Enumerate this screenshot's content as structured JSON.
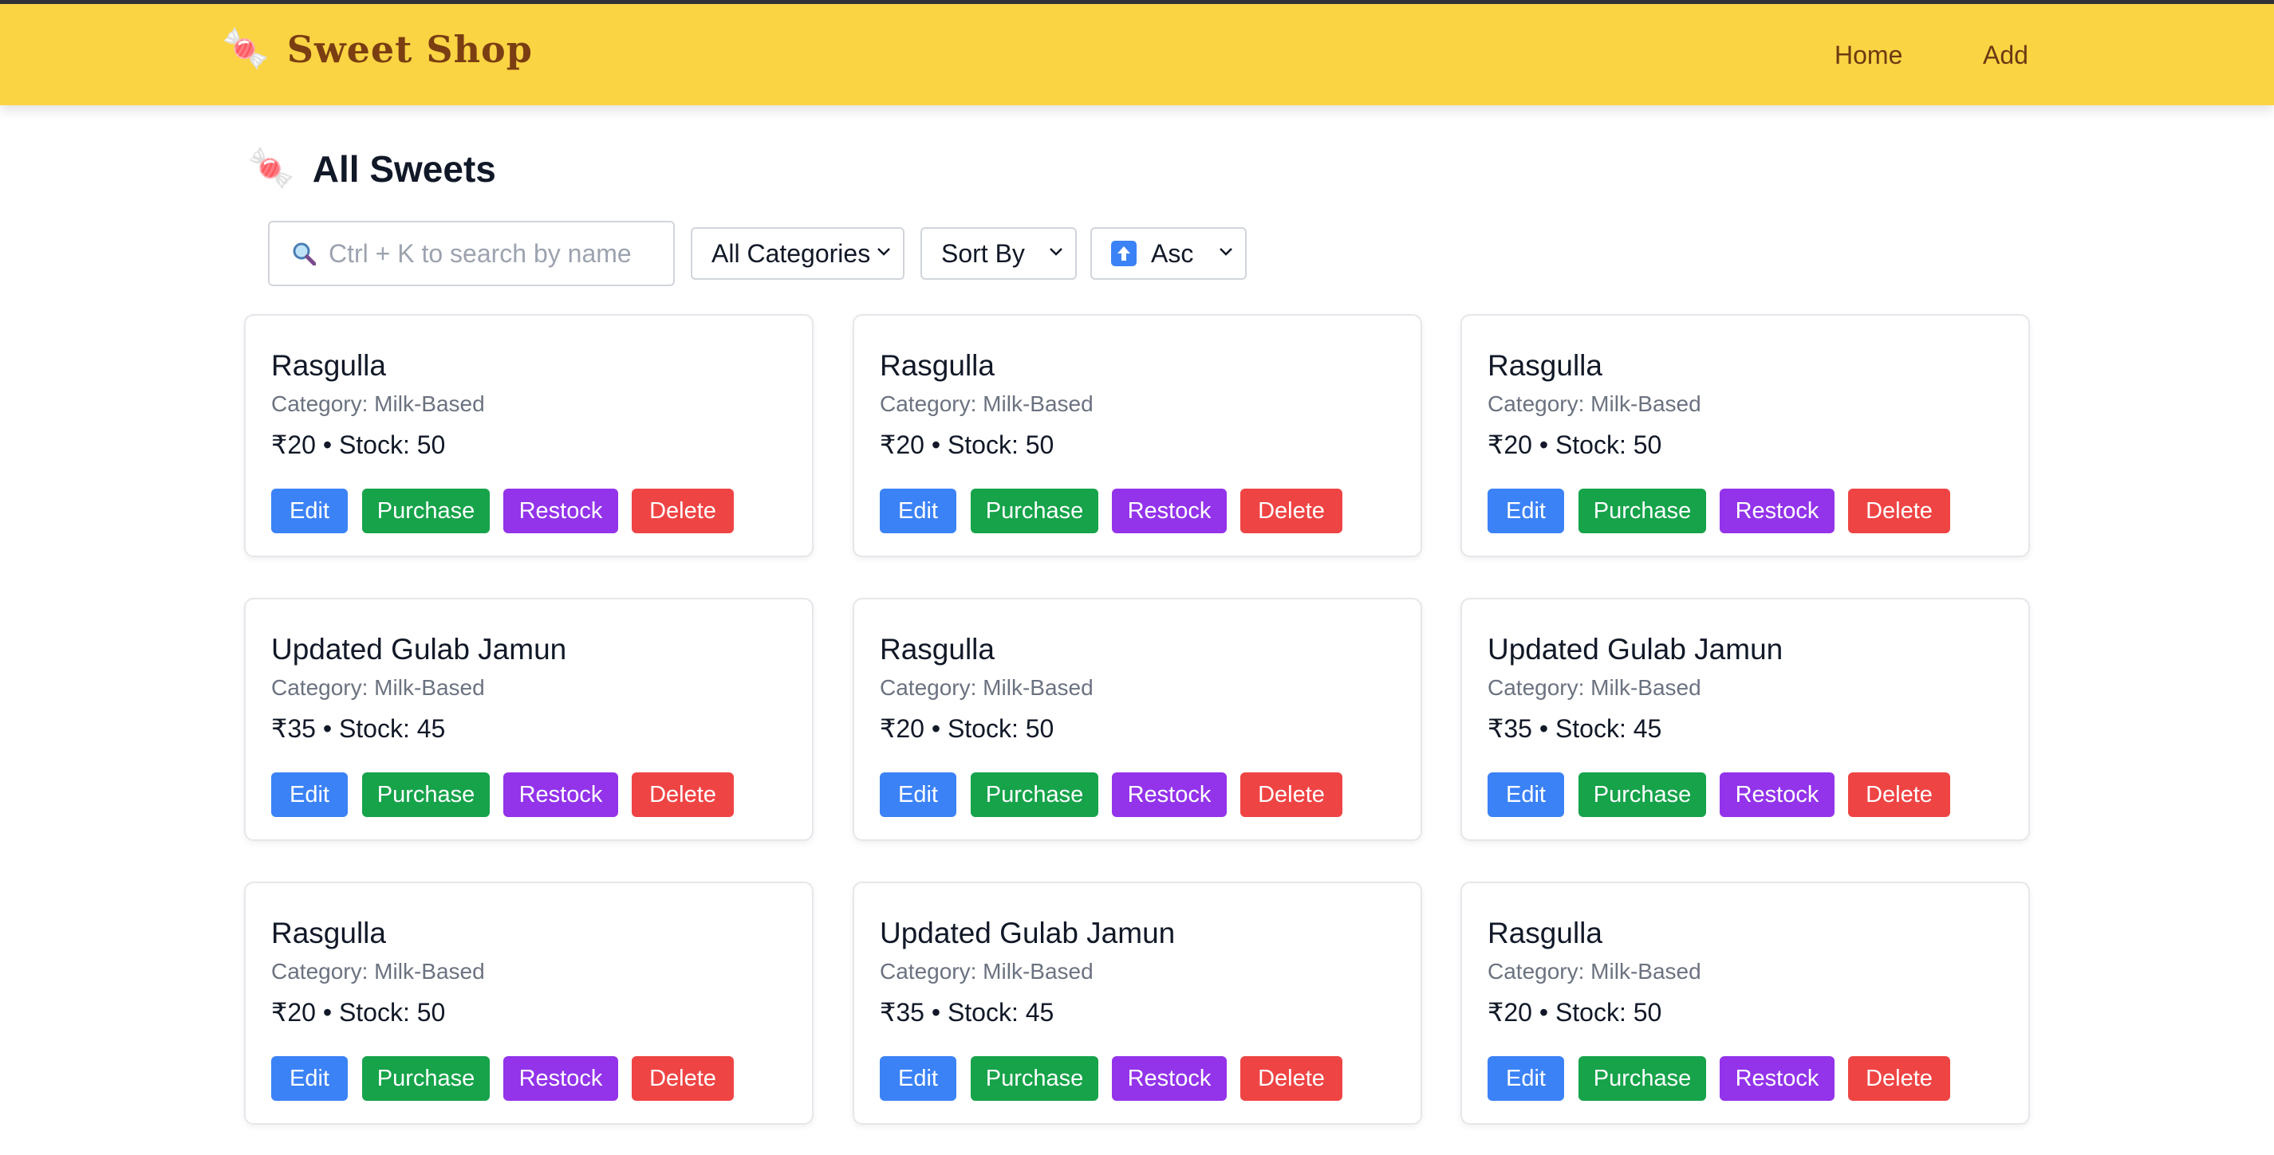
{
  "brand": {
    "icon": "candy-icon",
    "name": "Sweet Shop"
  },
  "nav": {
    "home": "Home",
    "add": "Add"
  },
  "page": {
    "icon": "candy-icon",
    "title": "All Sweets"
  },
  "controls": {
    "search_placeholder": "Ctrl + K to search by name",
    "category_select": "All Categories",
    "sort_select": "Sort By",
    "order_select": "Asc"
  },
  "buttons": {
    "edit": "Edit",
    "purchase": "Purchase",
    "restock": "Restock",
    "delete": "Delete"
  },
  "sweets": [
    {
      "name": "Rasgulla",
      "category": "Category: Milk-Based",
      "details": "₹20 • Stock: 50"
    },
    {
      "name": "Rasgulla",
      "category": "Category: Milk-Based",
      "details": "₹20 • Stock: 50"
    },
    {
      "name": "Rasgulla",
      "category": "Category: Milk-Based",
      "details": "₹20 • Stock: 50"
    },
    {
      "name": "Updated Gulab Jamun",
      "category": "Category: Milk-Based",
      "details": "₹35 • Stock: 45"
    },
    {
      "name": "Rasgulla",
      "category": "Category: Milk-Based",
      "details": "₹20 • Stock: 50"
    },
    {
      "name": "Updated Gulab Jamun",
      "category": "Category: Milk-Based",
      "details": "₹35 • Stock: 45"
    },
    {
      "name": "Rasgulla",
      "category": "Category: Milk-Based",
      "details": "₹20 • Stock: 50"
    },
    {
      "name": "Updated Gulab Jamun",
      "category": "Category: Milk-Based",
      "details": "₹35 • Stock: 45"
    },
    {
      "name": "Rasgulla",
      "category": "Category: Milk-Based",
      "details": "₹20 • Stock: 50"
    }
  ],
  "colors": {
    "navbar": "#fad443",
    "brand_text": "#7a3e12",
    "edit": "#3b82f6",
    "purchase": "#16a34a",
    "restock": "#9333ea",
    "delete": "#ef4444"
  }
}
